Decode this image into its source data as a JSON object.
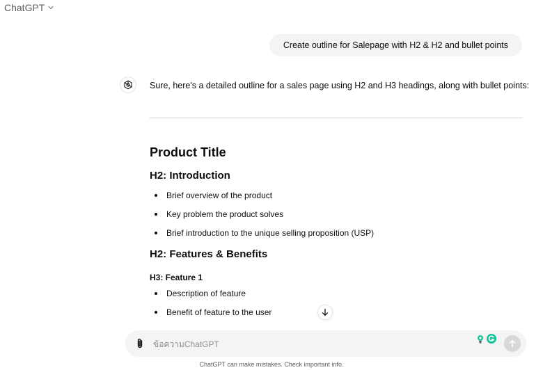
{
  "header": {
    "model_name": "ChatGPT"
  },
  "conversation": {
    "user_message": "Create outline for Salepage with H2 & H2 and bullet points",
    "assistant": {
      "intro": "Sure, here's a detailed outline for a sales page using H2 and H3 headings, along with bullet points:",
      "product_title": "Product Title",
      "section_intro": {
        "heading": "H2: Introduction",
        "bullets": [
          "Brief overview of the product",
          "Key problem the product solves",
          "Brief introduction to the unique selling proposition (USP)"
        ]
      },
      "section_features": {
        "heading": "H2: Features & Benefits",
        "subheading": "H3: Feature 1",
        "bullets": [
          "Description of feature",
          "Benefit of feature to the user"
        ]
      }
    }
  },
  "composer": {
    "placeholder": "ข้อความChatGPT"
  },
  "footer": {
    "note": "ChatGPT can make mistakes. Check important info."
  },
  "icons": {
    "model_dropdown": "chevron-down-icon",
    "assistant_avatar": "openai-logo-icon",
    "scroll_down": "arrow-down-icon",
    "attach": "paperclip-icon",
    "extension_1": "lightbulb-icon",
    "extension_2": "grammarly-icon",
    "send": "arrow-up-icon"
  },
  "colors": {
    "user_bubble_bg": "#f4f4f4",
    "composer_bg": "#f4f4f4",
    "send_button_disabled": "#d7d7d7",
    "grammarly_green": "#15c39a",
    "text": "#0d0d0d",
    "muted_text": "#5d5d5d"
  }
}
